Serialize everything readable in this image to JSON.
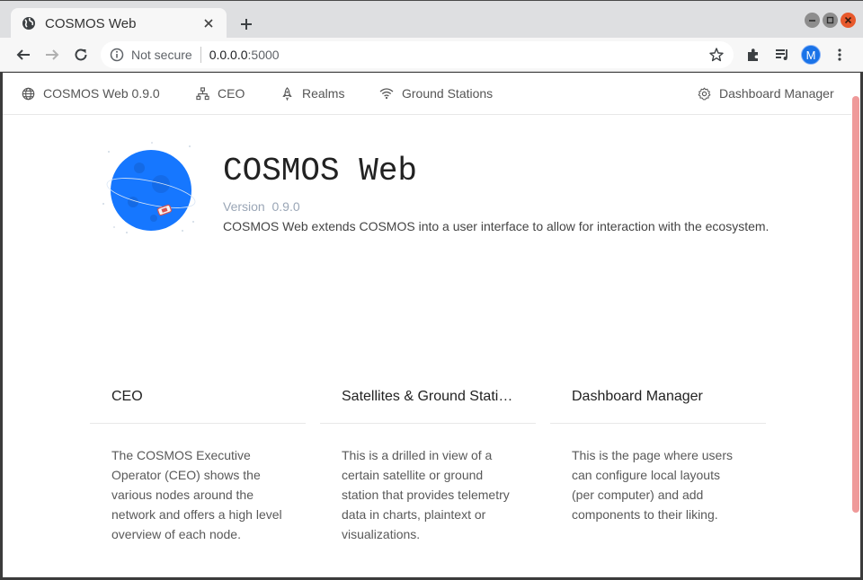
{
  "browser": {
    "tab_title": "COSMOS Web",
    "security_label": "Not secure",
    "url_host": "0.0.0.0",
    "url_port": ":5000",
    "profile_initial": "M"
  },
  "nav": {
    "brand": "COSMOS Web 0.9.0",
    "ceo": "CEO",
    "realms": "Realms",
    "ground_stations": "Ground Stations",
    "dashboard_manager": "Dashboard Manager"
  },
  "hero": {
    "title": "COSMOS Web",
    "version_label": "Version",
    "version": "0.9.0",
    "description": "COSMOS Web extends COSMOS into a user interface to allow for interaction with the ecosystem."
  },
  "cards": [
    {
      "title": "CEO",
      "body": "The COSMOS Executive Operator (CEO) shows the various nodes around the network and offers a high level overview of each node."
    },
    {
      "title": "Satellites & Ground Stations",
      "body": "This is a drilled in view of a certain satellite or ground station that provides telemetry data in charts, plaintext or visualizations."
    },
    {
      "title": "Dashboard Manager",
      "body": "This is the page where users can configure local layouts (per computer) and add components to their liking."
    }
  ],
  "colors": {
    "logo_blue": "#1677ff",
    "scroll_thumb": "#ef9a9a",
    "version_text": "#9aa6b6"
  },
  "icons": {
    "nav_brand": "global-icon",
    "nav_ceo": "cluster-icon",
    "nav_realms": "rocket-icon",
    "nav_ground_stations": "wifi-icon",
    "nav_dashboard_manager": "setting-icon"
  }
}
